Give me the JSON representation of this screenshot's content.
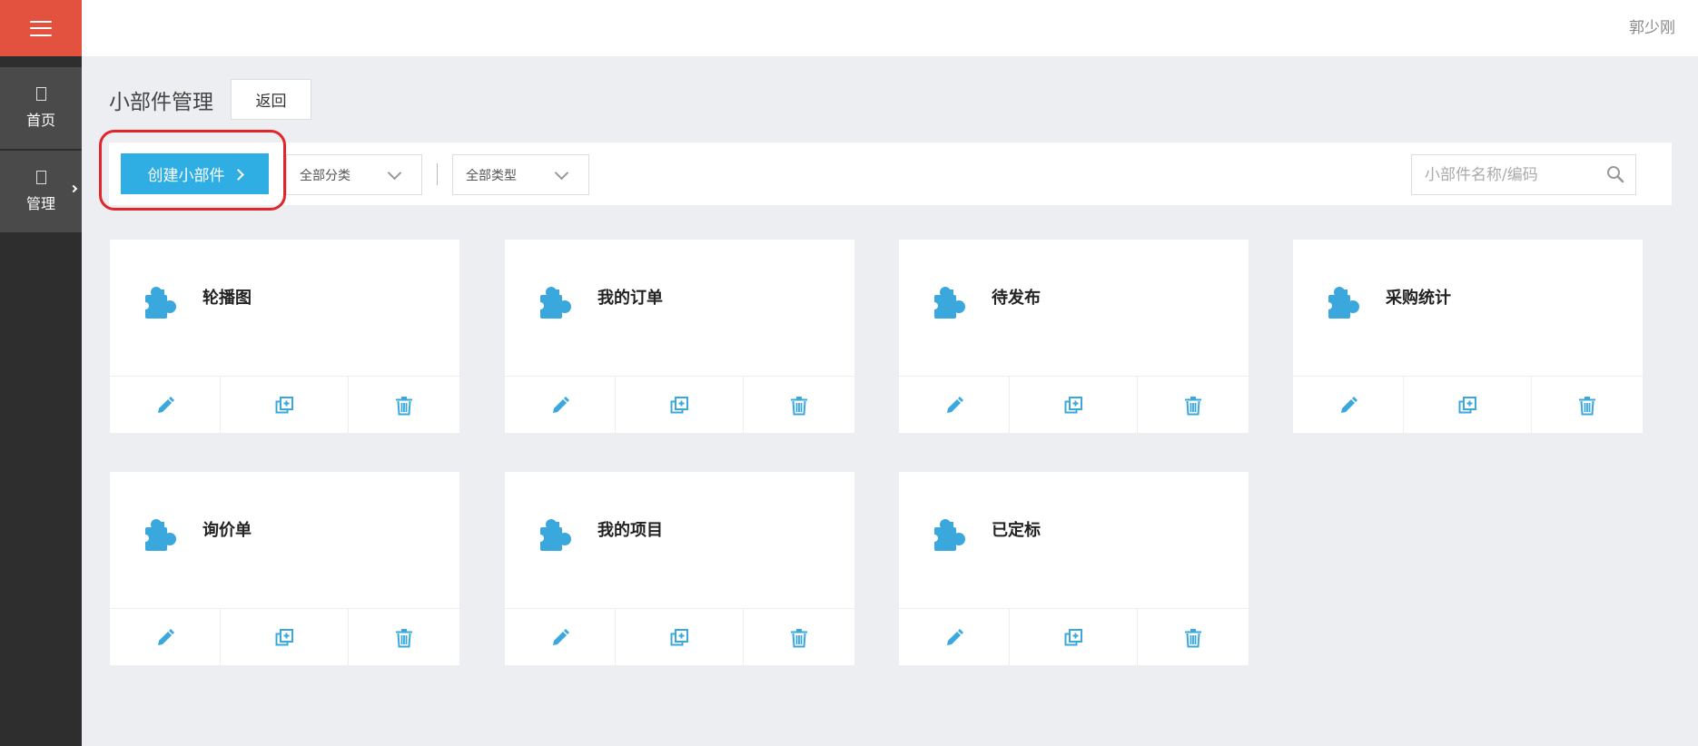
{
  "header": {
    "user_name": "郭少刚"
  },
  "sidebar": {
    "menu_icon": "hamburger-icon",
    "items": [
      {
        "label": "首页",
        "icon": "home-icon"
      },
      {
        "label": "管理",
        "icon": "manage-icon"
      }
    ]
  },
  "page": {
    "title": "小部件管理",
    "back_label": "返回"
  },
  "toolbar": {
    "create_label": "创建小部件",
    "category_select": "全部分类",
    "type_select": "全部类型",
    "search_placeholder": "小部件名称/编码"
  },
  "colors": {
    "accent": "#2eaee3",
    "menu_bg": "#e3523f",
    "highlight": "#e0252b",
    "icon": "#3aa8dd"
  },
  "widgets": [
    {
      "title": "轮播图"
    },
    {
      "title": "我的订单"
    },
    {
      "title": "待发布"
    },
    {
      "title": "采购统计"
    },
    {
      "title": "询价单"
    },
    {
      "title": "我的项目"
    },
    {
      "title": "已定标"
    }
  ],
  "card_actions": [
    "edit-icon",
    "copy-icon",
    "delete-icon"
  ]
}
